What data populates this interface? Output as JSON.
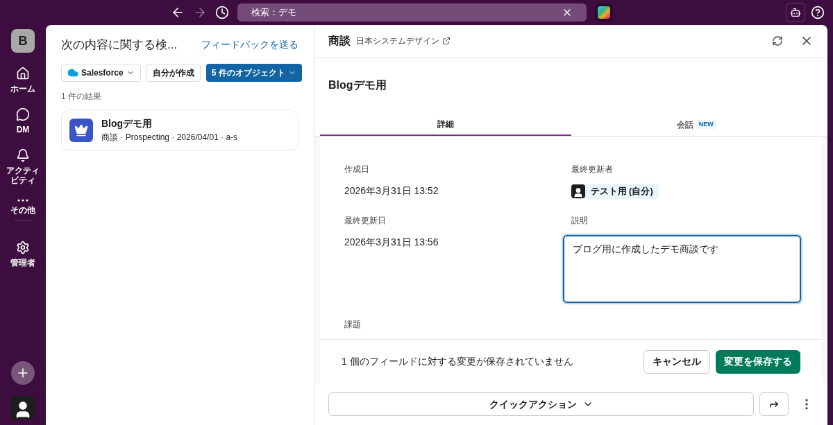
{
  "topbar": {
    "search_value": "検索：デモ"
  },
  "sidebar": {
    "workspace": "B",
    "items": [
      {
        "label": "ホーム",
        "kind": "home"
      },
      {
        "label": "DM",
        "kind": "dm"
      },
      {
        "label": "アクティビティ",
        "kind": "activity"
      },
      {
        "label": "その他",
        "kind": "more"
      },
      {
        "label": "管理者",
        "kind": "admin"
      }
    ]
  },
  "results_panel": {
    "title": "次の内容に関する検...",
    "feedback_link": "フィードバックを送る",
    "filters": [
      {
        "label": "Salesforce",
        "kind": "source",
        "selected": false
      },
      {
        "label": "自分が作成",
        "kind": "plain",
        "selected": false
      },
      {
        "label": "5 件のオブジェクト",
        "kind": "dropdown",
        "selected": true
      }
    ],
    "count": "1 件の結果",
    "results": [
      {
        "title": "Blogデモ用",
        "meta": "商談 · Prospecting · 2026/04/01 · a-s"
      }
    ]
  },
  "record_panel": {
    "object": "商談",
    "account": "日本システムデザイン",
    "record_title": "Blogデモ用",
    "tabs": [
      {
        "label": "詳細",
        "selected": true
      },
      {
        "label": "会話",
        "badge": "NEW",
        "selected": false
      }
    ],
    "fields": [
      {
        "label": "作成日",
        "value": "2026年3月31日 13:52",
        "kind": "text"
      },
      {
        "label": "最終更新者",
        "value": "テスト用 (自分)",
        "kind": "user"
      },
      {
        "label": "最終更新日",
        "value": "2026年3月31日 13:56",
        "kind": "text"
      },
      {
        "label": "説明",
        "value": "ブログ用に作成したデモ商談です",
        "kind": "textarea"
      },
      {
        "label": "課題",
        "kind": "empty"
      }
    ],
    "unsaved_message": "1 個のフィールドに対する変更が保存されていません",
    "buttons": [
      {
        "label": "キャンセル",
        "kind": "secondary"
      },
      {
        "label": "変更を保存する",
        "kind": "primary"
      }
    ],
    "quick_action": "クイックアクション"
  }
}
